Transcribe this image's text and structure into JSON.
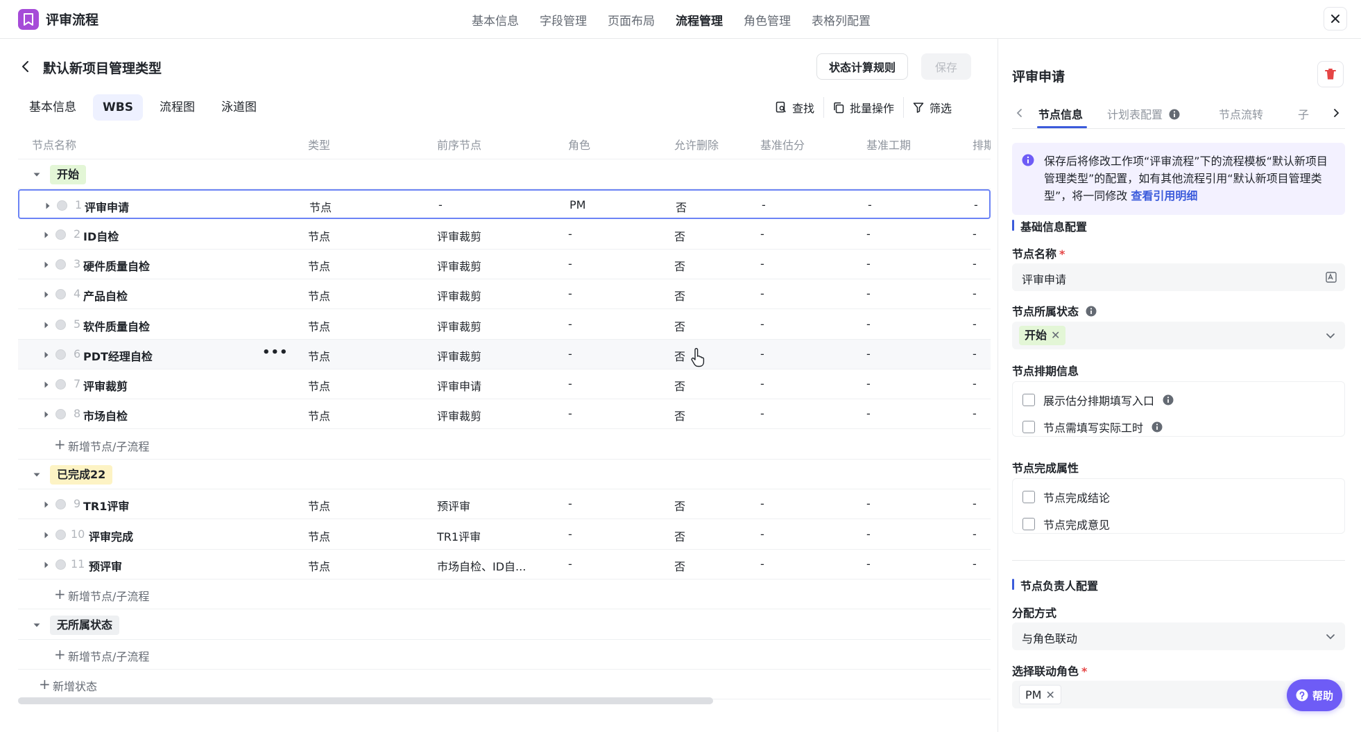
{
  "topbar": {
    "app_title": "评审流程",
    "nav": [
      "基本信息",
      "字段管理",
      "页面布局",
      "流程管理",
      "角色管理",
      "表格列配置"
    ],
    "active_nav": "流程管理"
  },
  "page": {
    "title": "默认新项目管理类型",
    "rule_button": "状态计算规则",
    "save_button": "保存"
  },
  "view_tabs": [
    "基本信息",
    "WBS",
    "流程图",
    "泳道图"
  ],
  "active_view_tab": "WBS",
  "toolbar": {
    "find": "查找",
    "batch": "批量操作",
    "filter": "筛选"
  },
  "table": {
    "columns": [
      "节点名称",
      "类型",
      "前序节点",
      "角色",
      "允许删除",
      "基准估分",
      "基准工期",
      "排期"
    ],
    "add_node_label": "新增节点/子流程",
    "add_state_label": "新增状态",
    "groups": [
      {
        "name": "开始",
        "tag_color": "#e3f6d6",
        "rows": [
          {
            "num": "1",
            "name": "评审申请",
            "type": "节点",
            "prev": "-",
            "role": "PM",
            "deletable": "否",
            "est": "-",
            "dur": "-",
            "sched": "-"
          },
          {
            "num": "2",
            "name": "ID自检",
            "type": "节点",
            "prev": "评审裁剪",
            "role": "-",
            "deletable": "否",
            "est": "-",
            "dur": "-",
            "sched": "-"
          },
          {
            "num": "3",
            "name": "硬件质量自检",
            "type": "节点",
            "prev": "评审裁剪",
            "role": "-",
            "deletable": "否",
            "est": "-",
            "dur": "-",
            "sched": "-"
          },
          {
            "num": "4",
            "name": "产品自检",
            "type": "节点",
            "prev": "评审裁剪",
            "role": "-",
            "deletable": "否",
            "est": "-",
            "dur": "-",
            "sched": "-"
          },
          {
            "num": "5",
            "name": "软件质量自检",
            "type": "节点",
            "prev": "评审裁剪",
            "role": "-",
            "deletable": "否",
            "est": "-",
            "dur": "-",
            "sched": "-"
          },
          {
            "num": "6",
            "name": "PDT经理自检",
            "type": "节点",
            "prev": "评审裁剪",
            "role": "-",
            "deletable": "否",
            "est": "-",
            "dur": "-",
            "sched": "-"
          },
          {
            "num": "7",
            "name": "评审裁剪",
            "type": "节点",
            "prev": "评审申请",
            "role": "-",
            "deletable": "否",
            "est": "-",
            "dur": "-",
            "sched": "-"
          },
          {
            "num": "8",
            "name": "市场自检",
            "type": "节点",
            "prev": "评审裁剪",
            "role": "-",
            "deletable": "否",
            "est": "-",
            "dur": "-",
            "sched": "-"
          }
        ]
      },
      {
        "name": "已完成22",
        "tag_color": "#fdf3c4",
        "rows": [
          {
            "num": "9",
            "name": "TR1评审",
            "type": "节点",
            "prev": "预评审",
            "role": "-",
            "deletable": "否",
            "est": "-",
            "dur": "-",
            "sched": "-"
          },
          {
            "num": "10",
            "name": "评审完成",
            "type": "节点",
            "prev": "TR1评审",
            "role": "-",
            "deletable": "否",
            "est": "-",
            "dur": "-",
            "sched": "-"
          },
          {
            "num": "11",
            "name": "预评审",
            "type": "节点",
            "prev": "市场自检、ID自...",
            "role": "-",
            "deletable": "否",
            "est": "-",
            "dur": "-",
            "sched": "-"
          }
        ]
      },
      {
        "name": "无所属状态",
        "tag_color": "#eef0f2",
        "rows": []
      }
    ]
  },
  "panel": {
    "title": "评审申请",
    "tabs": [
      "节点信息",
      "计划表配置",
      "节点流转",
      "子"
    ],
    "active_tab": "节点信息",
    "info_text": "保存后将修改工作项“评审流程”下的流程模板“默认新项目管理类型”的配置，如有其他流程引用“默认新项目管理类型”，将一同修改",
    "info_link": "查看引用明细",
    "basic_section": "基础信息配置",
    "node_name_label": "节点名称",
    "node_name_value": "评审申请",
    "node_state_label": "节点所属状态",
    "node_state_chip": "开始",
    "schedule_label": "节点排期信息",
    "schedule_options": [
      "展示估分排期填写入口",
      "节点需填写实际工时"
    ],
    "complete_label": "节点完成属性",
    "complete_options": [
      "节点完成结论",
      "节点完成意见"
    ],
    "owner_section": "节点负责人配置",
    "assign_label": "分配方式",
    "assign_value": "与角色联动",
    "role_label": "选择联动角色",
    "role_chip": "PM",
    "required_mark": "*"
  },
  "help_label": "帮助",
  "colors": {
    "accent": "#3b5bdb",
    "purple": "#6e5cf6",
    "danger": "#e54545"
  }
}
